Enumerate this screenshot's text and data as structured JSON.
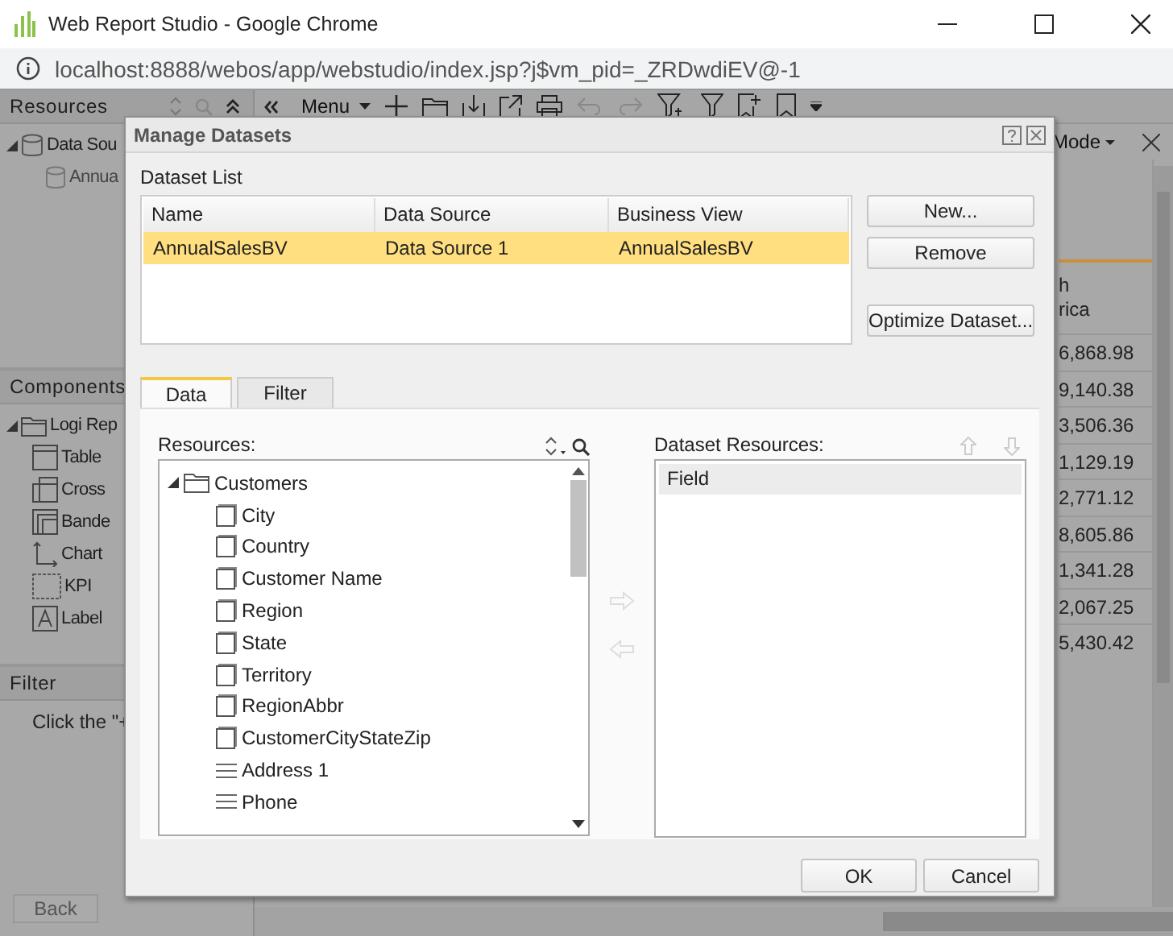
{
  "window": {
    "title": "Web Report Studio - Google Chrome",
    "url": "localhost:8888/webos/app/webstudio/index.jsp?j$vm_pid=_ZRDwdiEV@-1"
  },
  "resources_panel": {
    "title": "Resources",
    "tree": [
      {
        "label": "Data Sou",
        "expanded": true,
        "children": [
          {
            "label": "Annua"
          }
        ]
      }
    ]
  },
  "toolbar": {
    "menu_label": "Menu"
  },
  "components_panel": {
    "title": "Components",
    "tree": [
      {
        "label": "Logi Rep",
        "expanded": true,
        "children": [
          {
            "label": "Table",
            "kind": "table"
          },
          {
            "label": "Cross",
            "kind": "crosstab"
          },
          {
            "label": "Bande",
            "kind": "banded"
          },
          {
            "label": "Chart",
            "kind": "chart"
          },
          {
            "label": "KPI",
            "kind": "kpi"
          },
          {
            "label": "Label",
            "kind": "label"
          }
        ]
      }
    ]
  },
  "filter_panel": {
    "title": "Filter",
    "hint": "Click the \"+"
  },
  "nav_buttons": [
    {
      "label": "Back",
      "disabled": true
    }
  ],
  "report": {
    "mode_label": "Mode",
    "header_lines": [
      "h",
      "rica"
    ],
    "values": [
      "6,868.98",
      "9,140.38",
      "3,506.36",
      "1,129.19",
      "2,771.12",
      "8,605.86",
      "1,341.28",
      "2,067.25",
      "5,430.42"
    ]
  },
  "dialog": {
    "title": "Manage Datasets",
    "list_label": "Dataset List",
    "columns": [
      "Name",
      "Data Source",
      "Business View"
    ],
    "rows": [
      {
        "cells": [
          "AnnualSalesBV",
          "Data Source 1",
          "AnnualSalesBV"
        ],
        "selected": true
      }
    ],
    "side_buttons": [
      "New...",
      "Remove",
      "Optimize Dataset..."
    ],
    "tabs": [
      {
        "label": "Data",
        "selected": true
      },
      {
        "label": "Filter",
        "selected": false
      }
    ],
    "resources_label": "Resources:",
    "tree": [
      {
        "label": "Customers",
        "expanded": true,
        "children": [
          {
            "label": "City",
            "kind": "column"
          },
          {
            "label": "Country",
            "kind": "column"
          },
          {
            "label": "Customer Name",
            "kind": "column"
          },
          {
            "label": "Region",
            "kind": "column"
          },
          {
            "label": "State",
            "kind": "column"
          },
          {
            "label": "Territory",
            "kind": "column"
          },
          {
            "label": "RegionAbbr",
            "kind": "column"
          },
          {
            "label": "CustomerCityStateZip",
            "kind": "column"
          },
          {
            "label": "Address 1",
            "kind": "text"
          },
          {
            "label": "Phone",
            "kind": "text"
          }
        ]
      }
    ],
    "dataset_resources_label": "Dataset Resources:",
    "dataset_column": "Field",
    "footer_buttons": [
      "OK",
      "Cancel"
    ]
  }
}
